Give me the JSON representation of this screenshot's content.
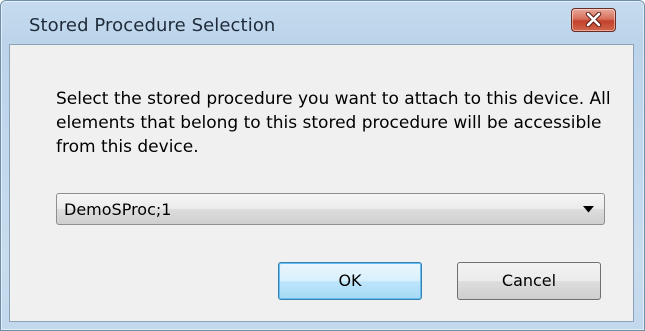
{
  "window": {
    "title": "Stored Procedure Selection",
    "close_icon": "close-icon"
  },
  "dialog": {
    "message": "Select the stored procedure you want to attach to this device. All elements that belong to this stored procedure will be accessible from this device.",
    "procedure_select": {
      "selected_value": "DemoSProc;1"
    },
    "ok_label": "OK",
    "cancel_label": "Cancel"
  },
  "colors": {
    "frame": "#c2d8ec",
    "client_background": "#f0f0f0",
    "close_button": "#c7432d",
    "default_button_border": "#3c7fb1"
  }
}
